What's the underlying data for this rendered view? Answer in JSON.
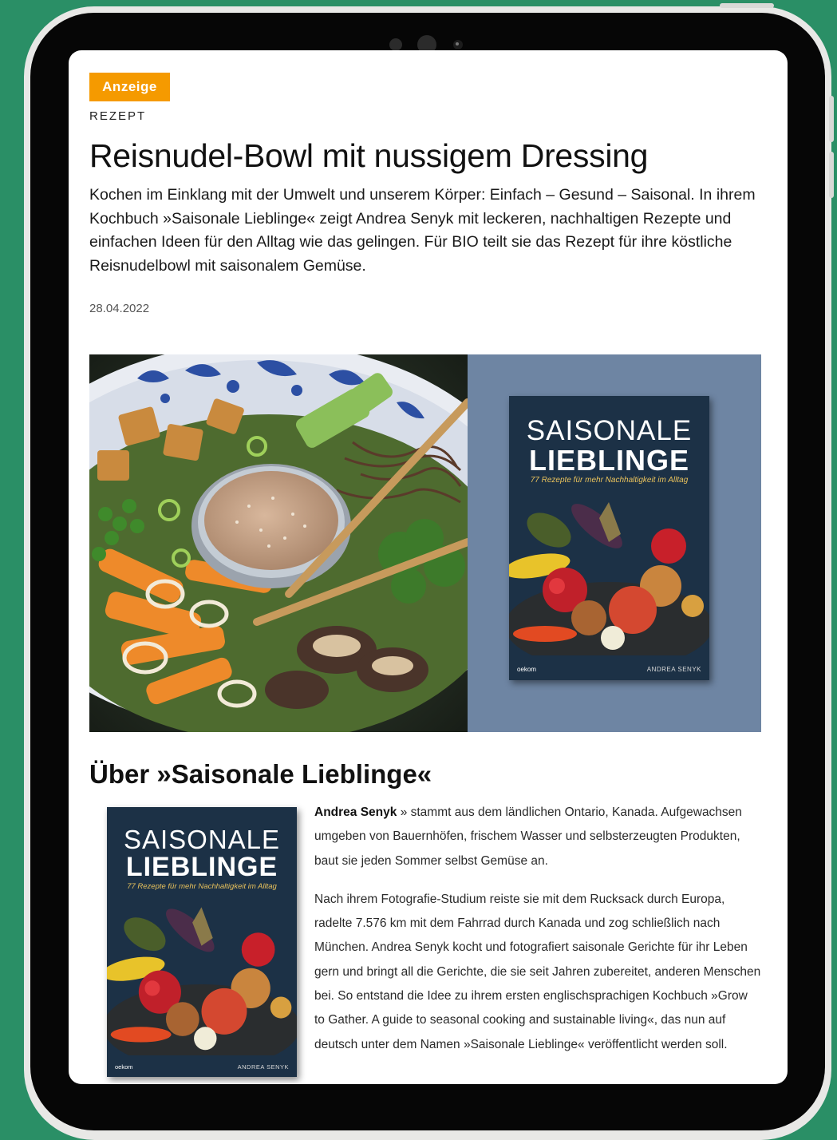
{
  "article": {
    "badge": "Anzeige",
    "category": "REZEPT",
    "title": "Reisnudel-Bowl mit nussigem Dressing",
    "lead": "Kochen im Einklang mit der Umwelt und unserem Körper: Einfach – Gesund – Saisonal. In ihrem Kochbuch »Saisonale Lieblinge« zeigt Andrea Senyk mit leckeren, nachhaltigen Rezepte und einfachen Ideen für den Alltag wie das gelingen. Für BIO teilt sie das Rezept für ihre köstliche Reisnudelbowl mit saisonalem Gemüse.",
    "date": "28.04.2022"
  },
  "book": {
    "title_line1": "SAISONALE",
    "title_line2": "LIEBLINGE",
    "subtitle": "77 Rezepte für mehr Nachhaltigkeit im Alltag",
    "publisher": "oekom",
    "author": "ANDREA SENYK"
  },
  "about": {
    "heading": "Über »Saisonale Lieblinge«",
    "bio_name": "Andrea Senyk",
    "bio_p1_rest": " » stammt aus dem ländlichen Ontario, Kanada. Aufgewachsen umgeben von Bauernhöfen, frischem Wasser und selbsterzeugten Produkten, baut sie jeden Sommer selbst Gemüse an.",
    "bio_p2": "Nach ihrem Fotografie-Studium reiste sie mit dem Rucksack durch Europa, radelte 7.576 km mit dem Fahrrad durch Kanada und zog schließlich nach München. Andrea Senyk kocht und fotografiert saisonale Gerichte für ihr Leben gern und bringt all die Gerichte, die sie seit Jahren zubereitet, anderen Menschen bei. So entstand die Idee zu ihrem ersten englischsprachigen Kochbuch »Grow to Gather. A guide to seasonal cooking and sustainable living«, das nun auf deutsch unter dem Namen »Saisonale Lieblinge« veröffentlicht werden soll."
  },
  "colors": {
    "background": "#2a8f66",
    "badge": "#f59a00",
    "hero_panel": "#6e85a3",
    "book_cover": "#1c3146"
  }
}
